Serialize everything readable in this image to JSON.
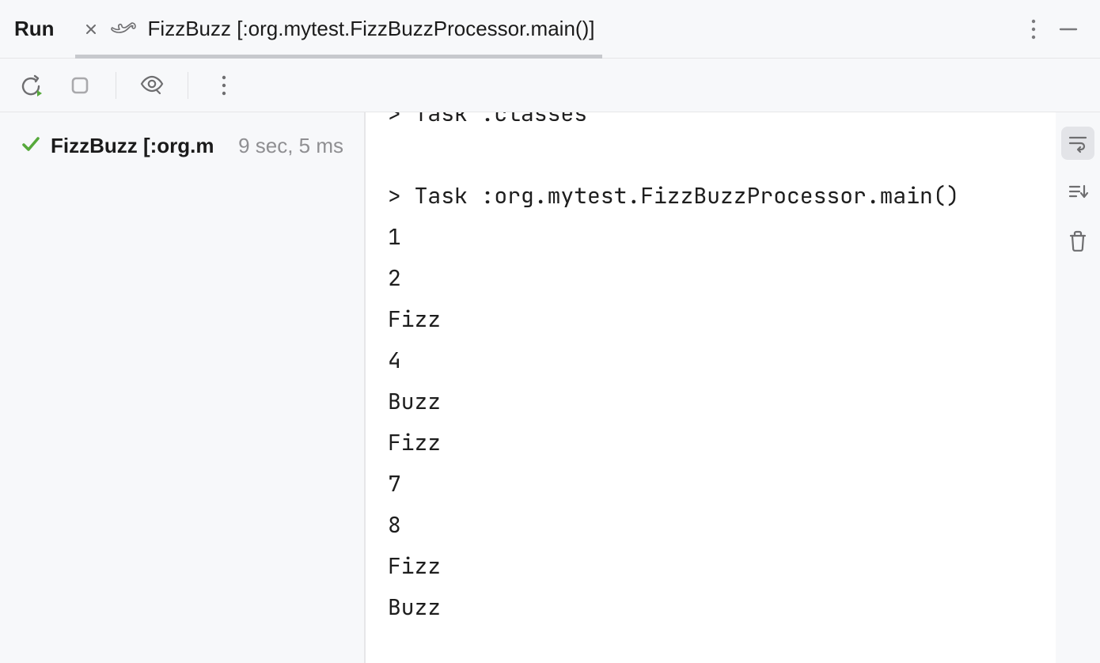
{
  "toolwindow": {
    "title": "Run"
  },
  "tab": {
    "label": "FizzBuzz [:org.mytest.FizzBuzzProcessor.main()]"
  },
  "tree": {
    "node": {
      "label": "FizzBuzz [:org.m",
      "duration": "9 sec, 5 ms"
    }
  },
  "console": {
    "lines": [
      "> Task :classes",
      "",
      "> Task :org.mytest.FizzBuzzProcessor.main()",
      "1",
      "2",
      "Fizz",
      "4",
      "Buzz",
      "Fizz",
      "7",
      "8",
      "Fizz",
      "Buzz"
    ]
  }
}
